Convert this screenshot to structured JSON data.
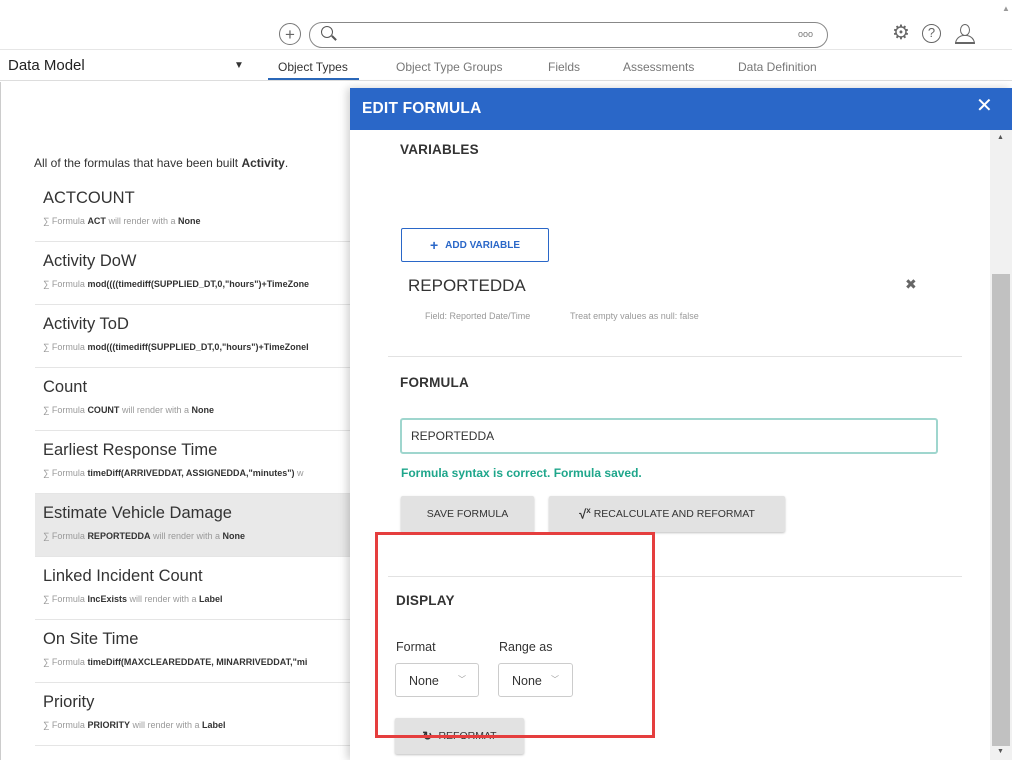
{
  "topbar": {
    "search": {
      "value": "",
      "placeholder": ""
    },
    "more_glyph": "ooo",
    "icons": [
      "add-icon",
      "search-icon",
      "more-icon",
      "gear-icon",
      "help-icon",
      "user-icon"
    ]
  },
  "nav": {
    "data_model": "Data Model",
    "tabs": [
      {
        "label": "Object Types",
        "active": true
      },
      {
        "label": "Object Type Groups",
        "active": false
      },
      {
        "label": "Fields",
        "active": false
      },
      {
        "label": "Assessments",
        "active": false
      },
      {
        "label": "Data Definition",
        "active": false
      }
    ]
  },
  "list": {
    "intro_prefix": "All of the formulas that have been built ",
    "intro_object": "Activity",
    "intro_suffix": ".",
    "items": [
      {
        "name": "ACTCOUNT",
        "prefix": "∑  Formula ",
        "formula": "ACT",
        "suffix": " will render with a ",
        "render": "None",
        "selected": false
      },
      {
        "name": "Activity DoW",
        "prefix": "∑  Formula ",
        "formula": "mod((((timediff(SUPPLIED_DT,0,\"hours\")+TimeZone",
        "suffix": "",
        "render": "",
        "selected": false
      },
      {
        "name": "Activity ToD",
        "prefix": "∑  Formula ",
        "formula": "mod(((timediff(SUPPLIED_DT,0,\"hours\")+TimeZoneI",
        "suffix": "",
        "render": "",
        "selected": false
      },
      {
        "name": "Count",
        "prefix": "∑  Formula ",
        "formula": "COUNT",
        "suffix": " will render with a ",
        "render": "None",
        "selected": false
      },
      {
        "name": "Earliest Response Time",
        "prefix": "∑  Formula ",
        "formula": "timeDiff(ARRIVEDDAT, ASSIGNEDDA,\"minutes\")",
        "suffix": " w",
        "render": "",
        "selected": false
      },
      {
        "name": "Estimate Vehicle Damage",
        "prefix": "∑  Formula ",
        "formula": "REPORTEDDA",
        "suffix": " will render with a ",
        "render": "None",
        "selected": true
      },
      {
        "name": "Linked Incident Count",
        "prefix": "∑  Formula ",
        "formula": "IncExists",
        "suffix": " will render with a ",
        "render": "Label",
        "selected": false
      },
      {
        "name": "On Site Time",
        "prefix": "∑  Formula ",
        "formula": "timeDiff(MAXCLEAREDDATE, MINARRIVEDDAT,\"mi",
        "suffix": "",
        "render": "",
        "selected": false
      },
      {
        "name": "Priority",
        "prefix": "∑  Formula ",
        "formula": "PRIORITY",
        "suffix": " will render with a ",
        "render": "Label",
        "selected": false
      }
    ]
  },
  "modal": {
    "title": "EDIT FORMULA",
    "close_glyph": "✕",
    "variables": {
      "heading": "VARIABLES",
      "add_button": "ADD VARIABLE",
      "add_glyph": "+",
      "item": {
        "name": "REPORTEDDA",
        "field": "Field: Reported Date/Time",
        "null_note": "Treat empty values as null: false",
        "remove_glyph": "✖"
      }
    },
    "formula": {
      "heading": "FORMULA",
      "value": "REPORTEDDA",
      "status": "Formula syntax is correct. Formula saved.",
      "save_button": "SAVE FORMULA",
      "recalc_button": "RECALCULATE AND REFORMAT",
      "sqrt_glyph": "√",
      "sqrt_sup": "x"
    },
    "display": {
      "heading": "DISPLAY",
      "format_label": "Format",
      "format_value": "None",
      "range_label": "Range as",
      "range_value": "None",
      "reformat_button": "REFORMAT",
      "refresh_glyph": "↻",
      "chevron_glyph": "﹀"
    }
  },
  "colors": {
    "header_blue": "#2a67c8",
    "success_green": "#1ea68b",
    "input_border": "#9fd6ce",
    "highlight_red": "#e53e3e",
    "selected_row": "#e9e9e9"
  }
}
